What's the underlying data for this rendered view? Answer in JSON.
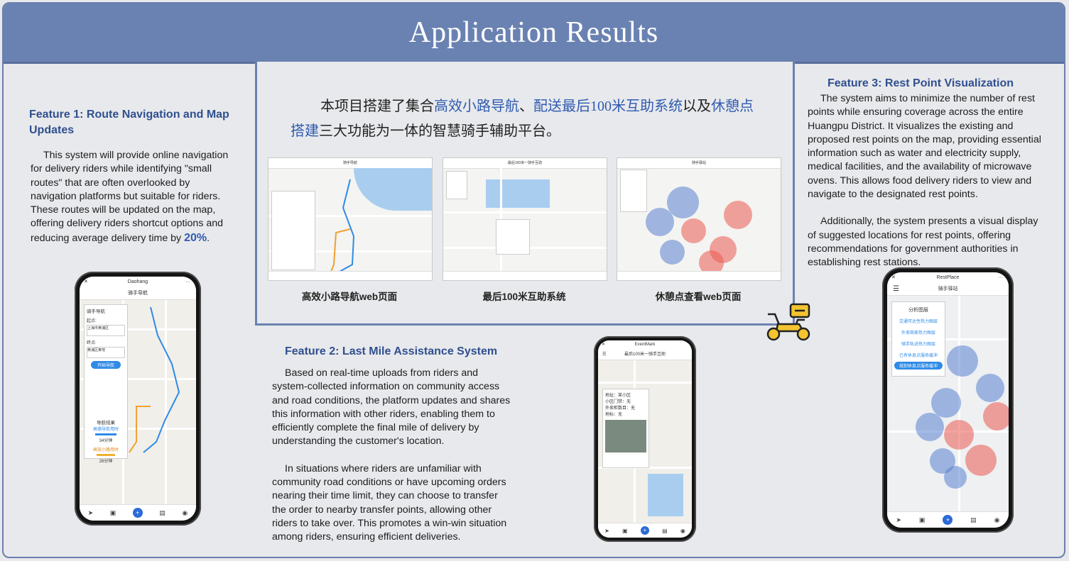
{
  "header": {
    "title": "Application Results"
  },
  "feature1": {
    "title": "Feature 1: Route Navigation and Map Updates",
    "body_pre": "This system will provide online navigation for delivery riders while identifying \"small routes\" that are often overlooked by navigation platforms but suitable for riders. These routes will be updated on the map, offering delivery riders shortcut options and reducing average delivery time by ",
    "body_highlight": "20%",
    "body_post": "."
  },
  "intro_cn": {
    "part1": "本项目搭建了集合",
    "hl1": "高效小路导航",
    "sep1": "、",
    "hl2": "送最后100米互助系统",
    "hl2_prefix": "配",
    "part2": "以及",
    "hl3": "休憩点搭建",
    "part3": "三大功能为一体的智慧骑手辅助平台。"
  },
  "screenshots": [
    {
      "title": "骑手导航",
      "caption": "高效小路导航web页面"
    },
    {
      "title": "最后100米一骑手互助",
      "caption": "最后100米互助系统"
    },
    {
      "title": "骑手驿站",
      "caption": "休憩点查看web页面"
    }
  ],
  "feature2": {
    "title": "Feature 2: Last Mile Assistance System",
    "para1": "Based on real-time uploads from riders and system-collected information on community access and road conditions, the platform updates and shares this information with other riders, enabling them to efficiently complete the final mile of delivery by understanding the customer's location.",
    "para2": "In situations where riders are unfamiliar with community road conditions or have upcoming orders nearing their time limit, they can choose to transfer the order to nearby transfer points, allowing other riders to take over. This promotes a win-win situation among riders, ensuring efficient deliveries."
  },
  "feature3": {
    "title": "Feature 3: Rest Point Visualization",
    "para1": "The system aims to minimize the number of rest points while ensuring coverage across the entire Huangpu District. It visualizes the existing and proposed rest points on the map, providing essential information such as water and electricity supply, medical facilities, and the availability of microwave ovens. This allows food delivery riders to view and navigate to the designated rest points.",
    "para2": "Additionally, the system presents a visual display of suggested locations for rest points, offering recommendations for government authorities in establishing rest stations."
  },
  "phone1": {
    "app_name": "Daohang",
    "page_title": "骑手导航",
    "panel_title": "骑手导航",
    "start_label": "起点:",
    "start_value": "上海市黄浦区",
    "end_label": "终点:",
    "end_value": "黄浦区某地",
    "button": "开始导航",
    "result_title": "导航结果",
    "result_1": "高德导航用时",
    "time_1": "34分钟",
    "result_2": "高效小路用时",
    "time_2": "28分钟"
  },
  "phone2": {
    "app_name": "EventMark",
    "page_title": "最后100米一骑手互助",
    "info_1": "地址：某小区",
    "info_2": "小区门禁：无",
    "info_3": "外卖柜数目：无",
    "info_4": "地标：无"
  },
  "phone3": {
    "app_name": "RestPlace",
    "page_title": "骑手驿站",
    "panel_title": "分析图层",
    "layers": [
      "交通可达性热力图层",
      "外卖商家热力图层",
      "骑手轨迹热力图层",
      "已有休息点服务缓冲",
      "规划休息点服务缓冲"
    ]
  },
  "colors": {
    "header_bg": "#6a82b1",
    "feature_title": "#2f4f8f",
    "highlight": "#2f5bb0"
  },
  "icons": [
    "scooter-icon",
    "navigation-arrow-icon",
    "plus-icon",
    "user-icon",
    "menu-icon"
  ]
}
